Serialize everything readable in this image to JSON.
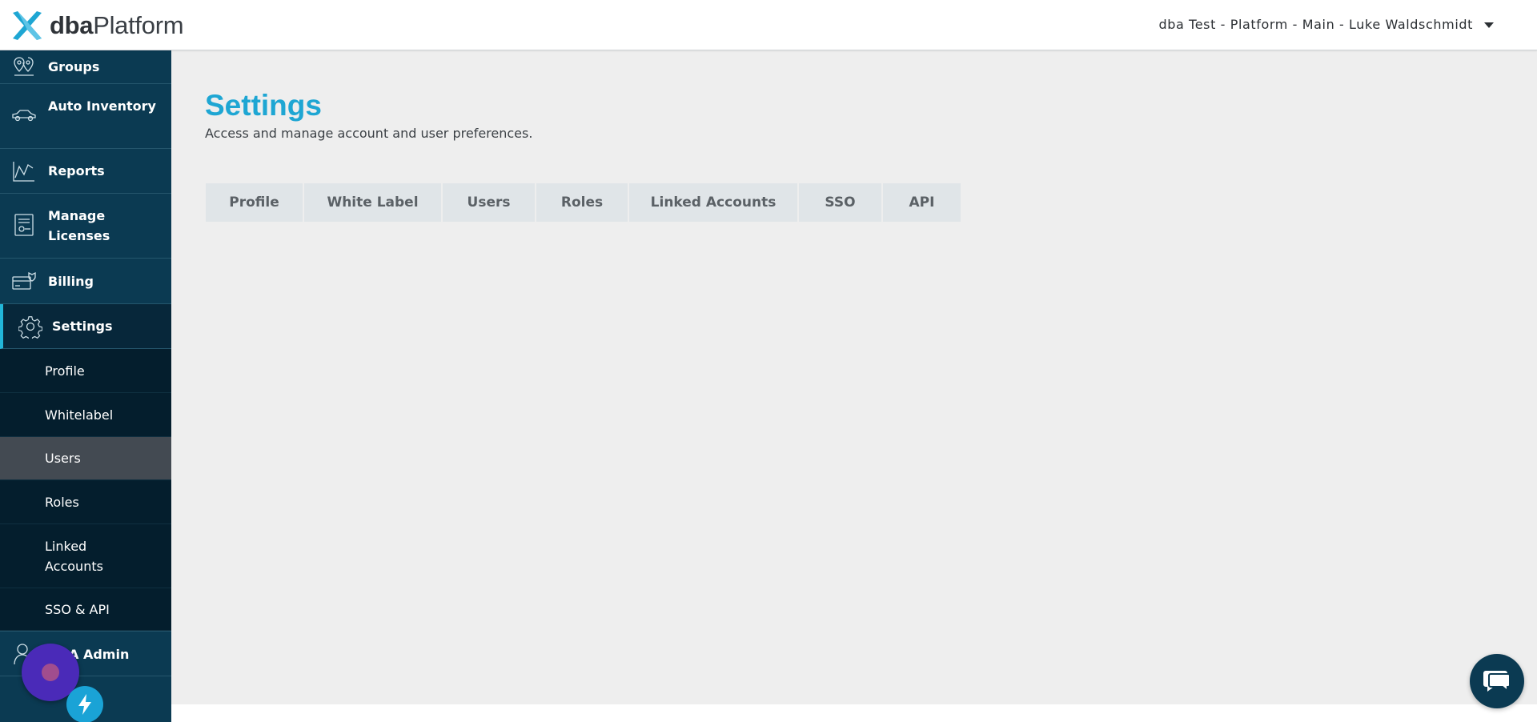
{
  "header": {
    "logo_bold": "dba",
    "logo_rest": "Platform",
    "account": "dba Test - Platform - Main - Luke Waldschmidt"
  },
  "sidebar": {
    "items": [
      {
        "label": "Groups",
        "icon": "map-pin-icon"
      },
      {
        "label": "Auto Inventory",
        "icon": "car-icon"
      },
      {
        "label": "Reports",
        "icon": "chart-line-icon"
      },
      {
        "label": "Manage Licenses",
        "icon": "license-icon"
      },
      {
        "label": "Billing",
        "icon": "credit-card-icon"
      },
      {
        "label": "Settings",
        "icon": "gear-icon"
      }
    ],
    "subitems": [
      {
        "label": "Profile"
      },
      {
        "label": "Whitelabel"
      },
      {
        "label": "Users"
      },
      {
        "label": "Roles"
      },
      {
        "label": "Linked Accounts"
      },
      {
        "label": "SSO & API"
      }
    ],
    "bottom_item": {
      "label": "A Admin",
      "icon": "user-icon"
    }
  },
  "page": {
    "title": "Settings",
    "subtitle": "Access and manage account and user preferences."
  },
  "tabs": [
    {
      "label": "Profile"
    },
    {
      "label": "White Label"
    },
    {
      "label": "Users"
    },
    {
      "label": "Roles"
    },
    {
      "label": "Linked Accounts"
    },
    {
      "label": "SSO"
    },
    {
      "label": "API"
    }
  ],
  "colors": {
    "accent": "#1ea6d3",
    "sidebar": "#0b3a52",
    "active_indicator": "#22b6d9",
    "submenu": "#041e2d",
    "selected_submenu": "#434a52"
  }
}
